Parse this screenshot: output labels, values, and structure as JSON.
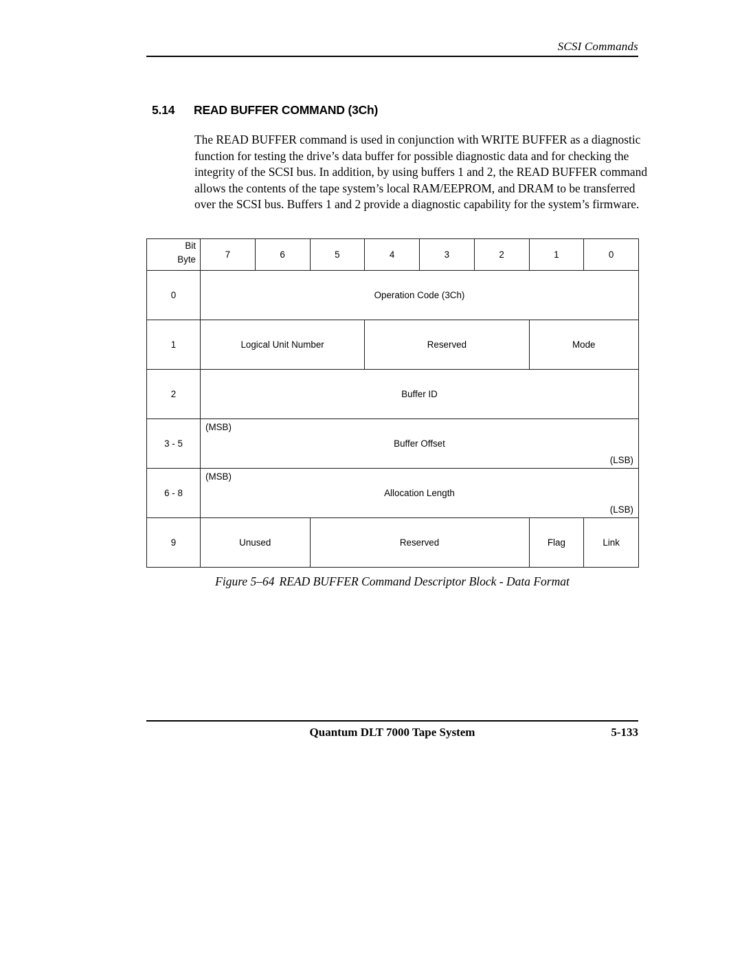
{
  "header": {
    "running_head": "SCSI Commands"
  },
  "section": {
    "number": "5.14",
    "title": "READ BUFFER COMMAND (3Ch)"
  },
  "body": {
    "paragraph": "The READ BUFFER command is used in conjunction with WRITE BUFFER as a diagnostic function for testing the drive’s data buffer for possible diagnostic data and for checking the integrity of the SCSI bus. In addition, by using buffers 1 and 2, the READ BUFFER command allows the contents of the tape system’s local RAM/EEPROM, and DRAM to be transferred over the SCSI bus. Buffers 1 and 2 provide a diagnostic capability for the system’s firmware."
  },
  "table": {
    "corner_top_label": "Bit",
    "corner_bottom_label": "Byte",
    "bit_headers": [
      "7",
      "6",
      "5",
      "4",
      "3",
      "2",
      "1",
      "0"
    ],
    "rows": [
      {
        "byte": "0",
        "cells": [
          {
            "label": "Operation Code (3Ch)",
            "span": 8
          }
        ]
      },
      {
        "byte": "1",
        "cells": [
          {
            "label": "Logical Unit Number",
            "span": 3
          },
          {
            "label": "Reserved",
            "span": 3
          },
          {
            "label": "Mode",
            "span": 2
          }
        ]
      },
      {
        "byte": "2",
        "cells": [
          {
            "label": "Buffer ID",
            "span": 8
          }
        ]
      },
      {
        "byte": "3 - 5",
        "cells": [
          {
            "label": "Buffer Offset",
            "span": 8,
            "msb": "(MSB)",
            "lsb": "(LSB)"
          }
        ]
      },
      {
        "byte": "6 - 8",
        "cells": [
          {
            "label": "Allocation Length",
            "span": 8,
            "msb": "(MSB)",
            "lsb": "(LSB)"
          }
        ]
      },
      {
        "byte": "9",
        "cells": [
          {
            "label": "Unused",
            "span": 2
          },
          {
            "label": "Reserved",
            "span": 4
          },
          {
            "label": "Flag",
            "span": 1
          },
          {
            "label": "Link",
            "span": 1
          }
        ]
      }
    ]
  },
  "figure": {
    "number": "Figure 5–64",
    "caption": "READ BUFFER Command Descriptor Block - Data Format"
  },
  "footer": {
    "center": "Quantum DLT 7000 Tape System",
    "page_number": "5-133"
  }
}
